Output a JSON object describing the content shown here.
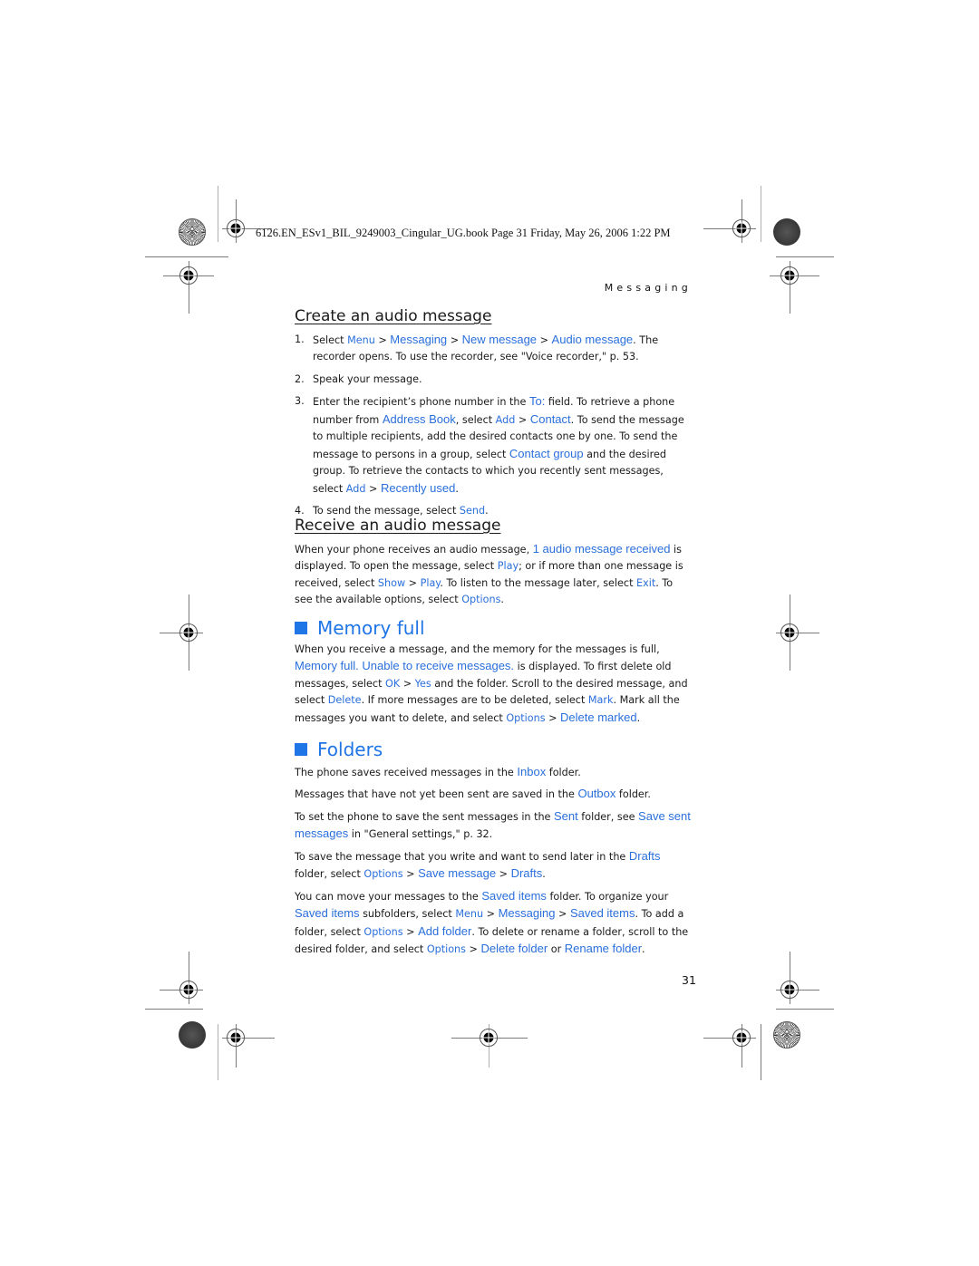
{
  "header": {
    "slug": "6126.EN_ESv1_BIL_9249003_Cingular_UG.book  Page 31  Friday, May 26, 2006  1:22 PM",
    "running_title": "Messaging"
  },
  "create_audio": {
    "heading": "Create an audio message",
    "steps": [
      {
        "num": "1.",
        "parts": [
          {
            "t": "Select "
          },
          {
            "s": "Menu"
          },
          {
            "t": " > "
          },
          {
            "h": "Messaging"
          },
          {
            "t": " > "
          },
          {
            "h": "New message"
          },
          {
            "t": " > "
          },
          {
            "h": "Audio message"
          },
          {
            "t": ". The recorder opens. To use the recorder, see \"Voice recorder,\" p. 53."
          }
        ]
      },
      {
        "num": "2.",
        "parts": [
          {
            "t": "Speak your message."
          }
        ]
      },
      {
        "num": "3.",
        "parts": [
          {
            "t": "Enter the recipient’s phone number in the "
          },
          {
            "h": "To:"
          },
          {
            "t": " field. To retrieve a phone number from "
          },
          {
            "h": "Address Book"
          },
          {
            "t": ", select "
          },
          {
            "s": "Add"
          },
          {
            "t": " > "
          },
          {
            "h": "Contact"
          },
          {
            "t": ". To send the message to multiple recipients, add the desired contacts one by one. To send the message to persons in a group, select "
          },
          {
            "h": "Contact group"
          },
          {
            "t": " and the desired group. To retrieve the contacts to which you recently sent messages, select "
          },
          {
            "s": "Add"
          },
          {
            "t": " > "
          },
          {
            "h": "Recently used"
          },
          {
            "t": "."
          }
        ]
      },
      {
        "num": "4.",
        "parts": [
          {
            "t": "To send the message, select "
          },
          {
            "s": "Send"
          },
          {
            "t": "."
          }
        ]
      }
    ]
  },
  "receive_audio": {
    "heading": "Receive an audio message",
    "paragraph": [
      {
        "t": "When your phone receives an audio message, "
      },
      {
        "h": "1 audio message received"
      },
      {
        "t": " is displayed. To open the message, select "
      },
      {
        "s": "Play"
      },
      {
        "t": "; or if more than one message is received, select "
      },
      {
        "s": "Show"
      },
      {
        "t": " > "
      },
      {
        "s": "Play"
      },
      {
        "t": ". To listen to the message later, select "
      },
      {
        "s": "Exit"
      },
      {
        "t": ". To see the available options, select "
      },
      {
        "s": "Options"
      },
      {
        "t": "."
      }
    ]
  },
  "memory_full": {
    "heading": "Memory full",
    "paragraph": [
      {
        "t": "When you receive a message, and the memory for the messages is full, "
      },
      {
        "h": "Memory full. Unable to receive messages."
      },
      {
        "t": " is displayed. To first delete old messages, select "
      },
      {
        "s": "OK"
      },
      {
        "t": " > "
      },
      {
        "s": "Yes"
      },
      {
        "t": " and the folder. Scroll to the desired message, and select "
      },
      {
        "s": "Delete"
      },
      {
        "t": ". If more messages are to be deleted, select "
      },
      {
        "s": "Mark"
      },
      {
        "t": ". Mark all the messages you want to delete, and select "
      },
      {
        "s": "Options"
      },
      {
        "t": " > "
      },
      {
        "h": "Delete marked"
      },
      {
        "t": "."
      }
    ]
  },
  "folders": {
    "heading": "Folders",
    "paragraphs": [
      [
        {
          "t": "The phone saves received messages in the "
        },
        {
          "h": "Inbox"
        },
        {
          "t": " folder."
        }
      ],
      [
        {
          "t": "Messages that have not yet been sent are saved in the "
        },
        {
          "h": "Outbox"
        },
        {
          "t": " folder."
        }
      ],
      [
        {
          "t": "To set the phone to save the sent messages in the "
        },
        {
          "h": "Sent"
        },
        {
          "t": " folder, see "
        },
        {
          "h": "Save sent messages"
        },
        {
          "t": " in \"General settings,\" p. 32."
        }
      ],
      [
        {
          "t": "To save the message that you write and want to send later in the "
        },
        {
          "h": "Drafts"
        },
        {
          "t": " folder, select "
        },
        {
          "s": "Options"
        },
        {
          "t": " > "
        },
        {
          "h": "Save message"
        },
        {
          "t": " > "
        },
        {
          "h": "Drafts"
        },
        {
          "t": "."
        }
      ],
      [
        {
          "t": "You can move your messages to the "
        },
        {
          "h": "Saved items"
        },
        {
          "t": " folder. To organize your "
        },
        {
          "h": "Saved items"
        },
        {
          "t": " subfolders, select "
        },
        {
          "s": "Menu"
        },
        {
          "t": " > "
        },
        {
          "h": "Messaging"
        },
        {
          "t": " > "
        },
        {
          "h": "Saved items"
        },
        {
          "t": ". To add a folder, select "
        },
        {
          "s": "Options"
        },
        {
          "t": " > "
        },
        {
          "h": "Add folder"
        },
        {
          "t": ". To delete or rename a folder, scroll to the desired folder, and select "
        },
        {
          "s": "Options"
        },
        {
          "t": " > "
        },
        {
          "h": "Delete folder"
        },
        {
          "t": " or "
        },
        {
          "h": "Rename folder"
        },
        {
          "t": "."
        }
      ]
    ]
  },
  "footer": {
    "page_number": "31"
  },
  "colors": {
    "highlight": "#2a6fdc",
    "section_heading": "#1f74e6",
    "text": "#1a1a1a"
  }
}
